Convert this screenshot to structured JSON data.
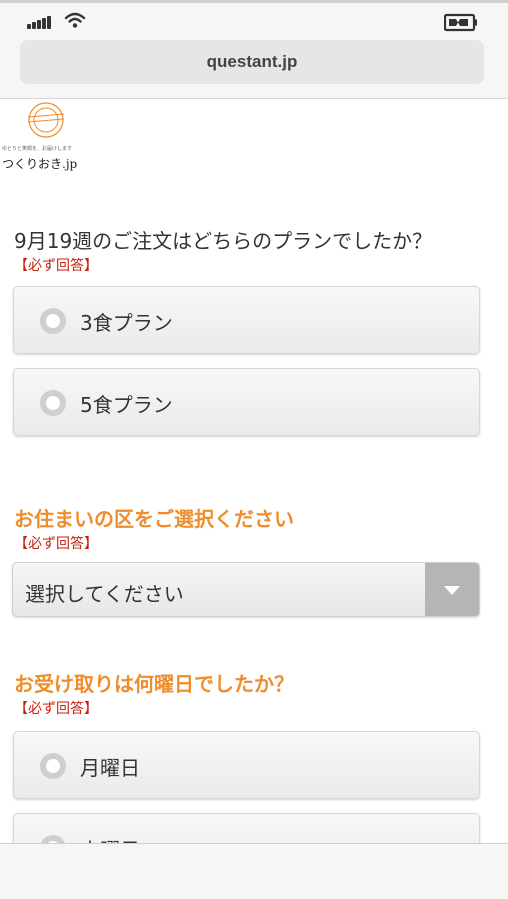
{
  "browser": {
    "url": "questant.jp"
  },
  "logo": {
    "tagline": "ゆとりと笑顔を、お届けします",
    "name": "つくりおき.jp"
  },
  "q1": {
    "title": "9月19週のご注文はどちらのプランでしたか？",
    "required": "【必ず回答】",
    "options": [
      {
        "label": "3食プラン"
      },
      {
        "label": "5食プラン"
      }
    ]
  },
  "q2": {
    "title": "お住まいの区をご選択ください",
    "required": "【必ず回答】",
    "select_value": "選択してください"
  },
  "q3": {
    "title": "お受け取りは何曜日でしたか？",
    "required": "【必ず回答】",
    "options": [
      {
        "label": "月曜日"
      },
      {
        "label": "火曜日"
      }
    ]
  },
  "colors": {
    "accent_orange": "#ef8d2c",
    "required_red": "#c4220f"
  }
}
